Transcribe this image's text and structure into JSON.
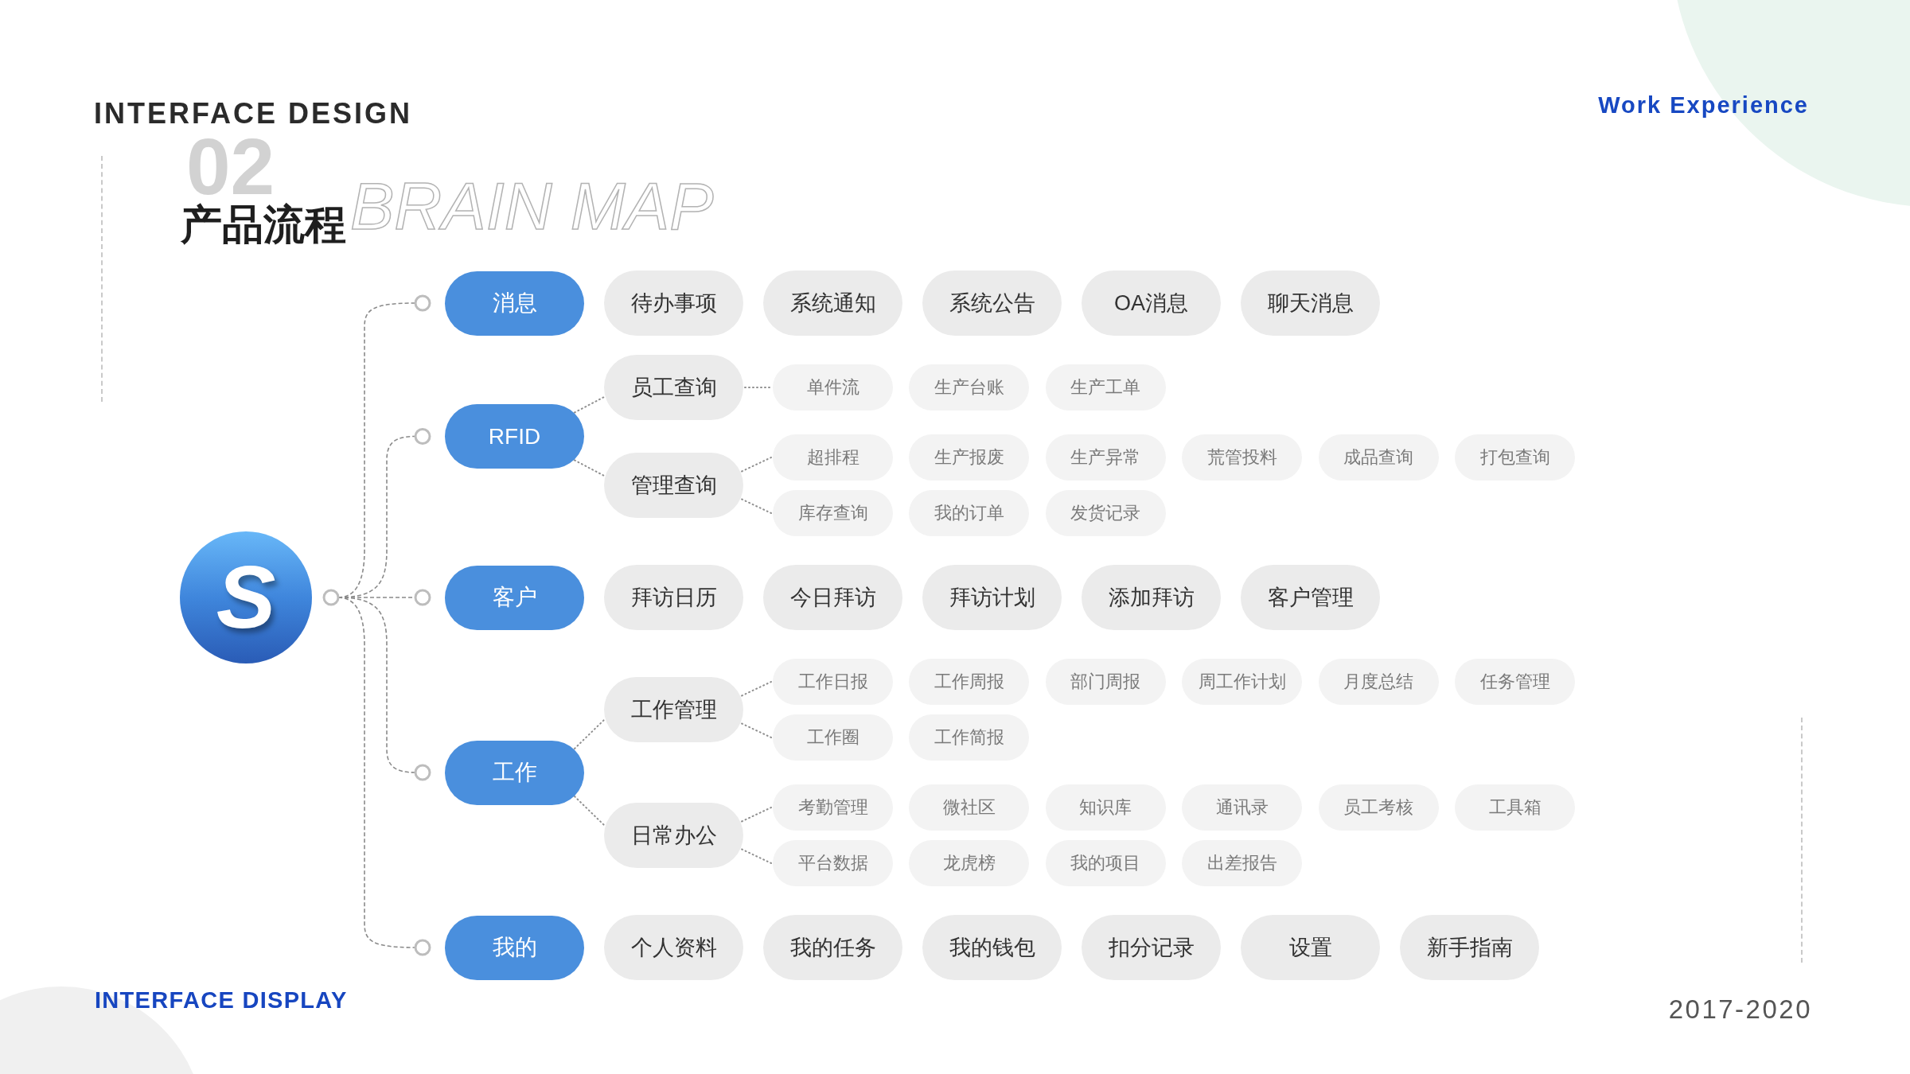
{
  "header": {
    "title": "INTERFACE DESIGN",
    "tagline": "Work Experience"
  },
  "section": {
    "number": "02",
    "subtitle": "BRAIN MAP",
    "title": "产品流程"
  },
  "logo": {
    "letter": "S"
  },
  "mind_map": {
    "branches": [
      {
        "label": "消息",
        "children": [
          {
            "label": "待办事项"
          },
          {
            "label": "系统通知"
          },
          {
            "label": "系统公告"
          },
          {
            "label": "OA消息"
          },
          {
            "label": "聊天消息"
          }
        ]
      },
      {
        "label": "RFID",
        "children": [
          {
            "label": "员工查询",
            "children": [
              {
                "label": "单件流"
              },
              {
                "label": "生产台账"
              },
              {
                "label": "生产工单"
              }
            ]
          },
          {
            "label": "管理查询",
            "children": [
              {
                "label": "超排程"
              },
              {
                "label": "生产报废"
              },
              {
                "label": "生产异常"
              },
              {
                "label": "荒管投料"
              },
              {
                "label": "成品查询"
              },
              {
                "label": "打包查询"
              },
              {
                "label": "库存查询"
              },
              {
                "label": "我的订单"
              },
              {
                "label": "发货记录"
              }
            ]
          }
        ]
      },
      {
        "label": "客户",
        "children": [
          {
            "label": "拜访日历"
          },
          {
            "label": "今日拜访"
          },
          {
            "label": "拜访计划"
          },
          {
            "label": "添加拜访"
          },
          {
            "label": "客户管理"
          }
        ]
      },
      {
        "label": "工作",
        "children": [
          {
            "label": "工作管理",
            "children": [
              {
                "label": "工作日报"
              },
              {
                "label": "工作周报"
              },
              {
                "label": "部门周报"
              },
              {
                "label": "周工作计划"
              },
              {
                "label": "月度总结"
              },
              {
                "label": "任务管理"
              },
              {
                "label": "工作圈"
              },
              {
                "label": "工作简报"
              }
            ]
          },
          {
            "label": "日常办公",
            "children": [
              {
                "label": "考勤管理"
              },
              {
                "label": "微社区"
              },
              {
                "label": "知识库"
              },
              {
                "label": "通讯录"
              },
              {
                "label": "员工考核"
              },
              {
                "label": "工具箱"
              },
              {
                "label": "平台数据"
              },
              {
                "label": "龙虎榜"
              },
              {
                "label": "我的项目"
              },
              {
                "label": "出差报告"
              }
            ]
          }
        ]
      },
      {
        "label": "我的",
        "children": [
          {
            "label": "个人资料"
          },
          {
            "label": "我的任务"
          },
          {
            "label": "我的钱包"
          },
          {
            "label": "扣分记录"
          },
          {
            "label": "设置"
          },
          {
            "label": "新手指南"
          }
        ]
      }
    ]
  },
  "footer": {
    "label": "INTERFACE DISPLAY",
    "years": "2017-2020"
  }
}
